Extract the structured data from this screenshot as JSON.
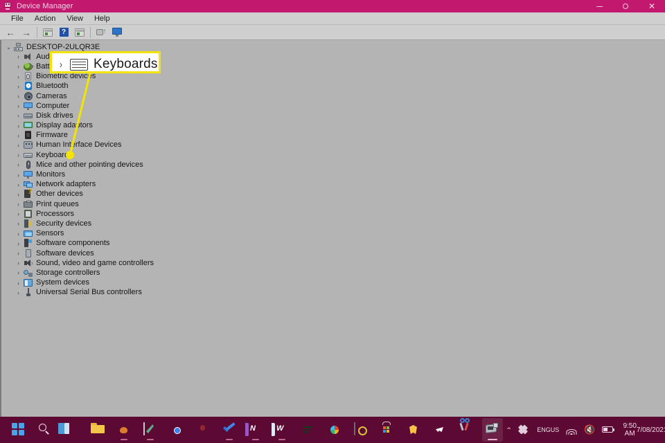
{
  "window": {
    "title": "Device Manager",
    "title_icon": "device-manager-icon",
    "controls": {
      "minimize": "–",
      "maximize": "○",
      "close": "✕"
    }
  },
  "menubar": {
    "items": [
      "File",
      "Action",
      "View",
      "Help"
    ]
  },
  "toolbar": {
    "buttons": [
      {
        "name": "back-button",
        "icon": "back-arrow-icon",
        "glyph": "←"
      },
      {
        "name": "forward-button",
        "icon": "forward-arrow-icon",
        "glyph": "→"
      },
      {
        "name": "properties-button",
        "icon": "properties-icon"
      },
      {
        "name": "help-button",
        "icon": "help-icon",
        "glyph": "?"
      },
      {
        "name": "show-hidden-button",
        "icon": "show-hidden-devices-icon"
      },
      {
        "name": "update-driver-button",
        "icon": "update-driver-icon"
      },
      {
        "name": "scan-hardware-button",
        "icon": "scan-for-hardware-changes-icon"
      }
    ]
  },
  "tree": {
    "root": {
      "label": "DESKTOP-2ULQR3E",
      "icon": "computer-icon",
      "expanded": true,
      "chevron": "⌄"
    },
    "items": [
      {
        "label": "Audio inputs and outputs",
        "icon": "speaker-icon",
        "chevron": "›"
      },
      {
        "label": "Batteries",
        "icon": "battery-icon",
        "chevron": "›"
      },
      {
        "label": "Biometric devices",
        "icon": "fingerprint-icon",
        "chevron": "›"
      },
      {
        "label": "Bluetooth",
        "icon": "bluetooth-icon",
        "chevron": "›"
      },
      {
        "label": "Cameras",
        "icon": "camera-icon",
        "chevron": "›"
      },
      {
        "label": "Computer",
        "icon": "monitor-icon",
        "chevron": "›"
      },
      {
        "label": "Disk drives",
        "icon": "disk-drive-icon",
        "chevron": "›"
      },
      {
        "label": "Display adaptors",
        "icon": "display-adapter-icon",
        "chevron": "›"
      },
      {
        "label": "Firmware",
        "icon": "firmware-chip-icon",
        "chevron": "›"
      },
      {
        "label": "Human Interface Devices",
        "icon": "hid-icon",
        "chevron": "›"
      },
      {
        "label": "Keyboards",
        "icon": "keyboard-icon",
        "chevron": "›"
      },
      {
        "label": "Mice and other pointing devices",
        "icon": "mouse-icon",
        "chevron": "›"
      },
      {
        "label": "Monitors",
        "icon": "monitor-icon",
        "chevron": "›"
      },
      {
        "label": "Network adapters",
        "icon": "network-adapter-icon",
        "chevron": "›"
      },
      {
        "label": "Other devices",
        "icon": "other-device-icon",
        "chevron": "›"
      },
      {
        "label": "Print queues",
        "icon": "printer-icon",
        "chevron": "›"
      },
      {
        "label": "Processors",
        "icon": "processor-icon",
        "chevron": "›"
      },
      {
        "label": "Security devices",
        "icon": "security-device-icon",
        "chevron": "›"
      },
      {
        "label": "Sensors",
        "icon": "sensor-icon",
        "chevron": "›"
      },
      {
        "label": "Software components",
        "icon": "software-component-icon",
        "chevron": "›"
      },
      {
        "label": "Software devices",
        "icon": "software-device-icon",
        "chevron": "›"
      },
      {
        "label": "Sound, video and game controllers",
        "icon": "sound-controller-icon",
        "chevron": "›"
      },
      {
        "label": "Storage controllers",
        "icon": "storage-controller-icon",
        "chevron": "›"
      },
      {
        "label": "System devices",
        "icon": "system-device-icon",
        "chevron": "›"
      },
      {
        "label": "Universal Serial Bus controllers",
        "icon": "usb-controller-icon",
        "chevron": "›"
      }
    ]
  },
  "callout": {
    "label": "Keyboards",
    "chevron": "›",
    "icon": "keyboard-icon",
    "border_color": "#f5e400",
    "background": "#ffffff"
  },
  "taskbar": {
    "background": "#5c0a33",
    "apps": [
      {
        "name": "start-button",
        "icon": "windows-start-icon",
        "running": false
      },
      {
        "name": "search-button",
        "icon": "search-icon",
        "running": false
      },
      {
        "name": "task-view-button",
        "icon": "widgets-icon",
        "running": false
      },
      {
        "name": "file-explorer-button",
        "icon": "folder-icon",
        "running": false
      },
      {
        "name": "edge-button",
        "icon": "edge-icon",
        "running": true
      },
      {
        "name": "sticky-notes-button",
        "icon": "note-icon",
        "running": true
      },
      {
        "name": "chrome-button",
        "icon": "chrome-icon",
        "running": false
      },
      {
        "name": "firefox-button",
        "icon": "firefox-icon",
        "running": false
      },
      {
        "name": "todo-button",
        "icon": "checkmark-icon",
        "running": true
      },
      {
        "name": "onenote-button",
        "icon": "onenote-icon",
        "running": true
      },
      {
        "name": "word-button",
        "icon": "word-icon",
        "running": true
      },
      {
        "name": "spotify-button",
        "icon": "spotify-icon",
        "running": false
      },
      {
        "name": "slack-button",
        "icon": "slack-icon",
        "running": false
      },
      {
        "name": "dark-app-button",
        "icon": "app-icon",
        "running": false
      },
      {
        "name": "microsoft-store-button",
        "icon": "microsoft-store-icon",
        "running": false
      },
      {
        "name": "brave-button",
        "icon": "brave-icon",
        "running": false
      },
      {
        "name": "telegram-button",
        "icon": "telegram-icon",
        "running": false
      },
      {
        "name": "snipping-tool-button",
        "icon": "scissors-icon",
        "running": false
      },
      {
        "name": "device-manager-button",
        "icon": "device-manager-icon",
        "running": true
      }
    ],
    "tray": {
      "overflow_chevron": "⌃",
      "dropbox_icon": "dropbox-icon",
      "language_line1": "ENG",
      "language_line2": "US",
      "wifi_icon": "wifi-icon",
      "volume_icon": "volume-muted-icon",
      "volume_glyph": "🔇",
      "battery_icon": "battery-charging-icon",
      "time": "9:50 AM",
      "date": "7/08/2021",
      "notification_icon": "moon-icon",
      "notification_glyph": "☽"
    }
  }
}
